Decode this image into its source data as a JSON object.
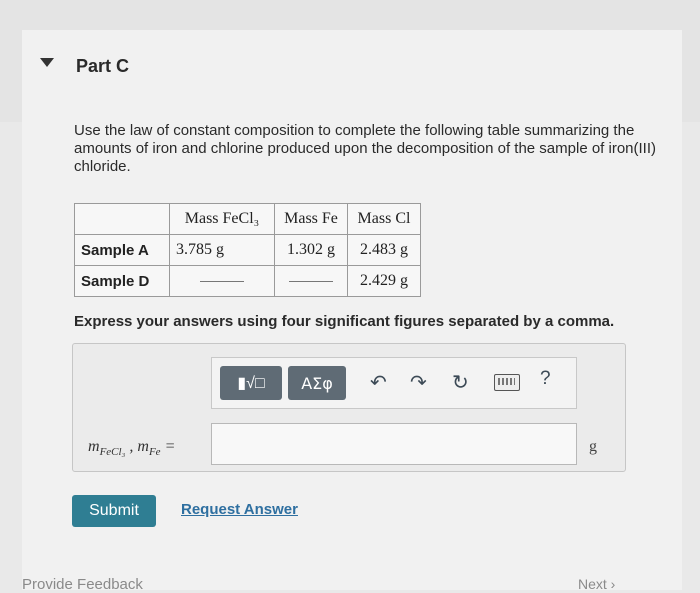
{
  "part": {
    "title": "Part C"
  },
  "prompt": "Use the law of constant composition to complete the following table summarizing the amounts of iron and chlorine produced upon the decomposition of the sample of iron(III) chloride.",
  "table": {
    "headers": [
      "",
      "Mass FeCl₃",
      "Mass Fe",
      "Mass Cl"
    ],
    "rows": [
      {
        "label": "Sample A",
        "mass_fecl3": "3.785 g",
        "mass_fe": "1.302 g",
        "mass_cl": "2.483 g"
      },
      {
        "label": "Sample D",
        "mass_fecl3": "",
        "mass_fe": "",
        "mass_cl": "2.429 g"
      }
    ]
  },
  "instruction": "Express your answers using four significant figures separated by a comma.",
  "toolbar": {
    "template_label": "▮√□",
    "symbols_label": "ΑΣφ",
    "undo_icon": "undo-icon",
    "redo_icon": "redo-icon",
    "reset_icon": "reset-icon",
    "keyboard_icon": "keyboard-icon",
    "help_label": "?"
  },
  "answer": {
    "var1": "m",
    "var1_sub": "FeCl₃",
    "separator": " , ",
    "var2": "m",
    "var2_sub": "Fe",
    "equals": " =",
    "value": "",
    "unit": "g"
  },
  "buttons": {
    "submit": "Submit",
    "request_answer": "Request Answer"
  },
  "footer": {
    "feedback": "Provide Feedback",
    "next": "Next ›"
  }
}
